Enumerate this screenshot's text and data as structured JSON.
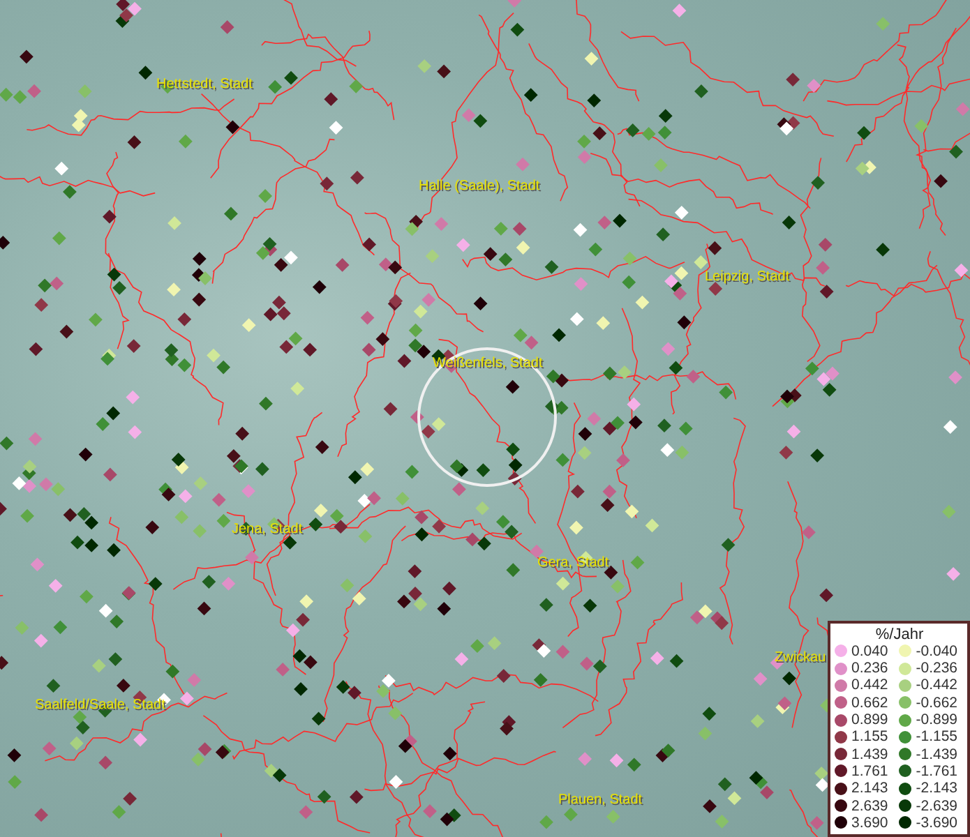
{
  "map": {
    "labels": [
      {
        "text": "Hettstedt, Stadt"
      },
      {
        "text": "Halle (Saale), Stadt"
      },
      {
        "text": "Leipzig, Stadt"
      },
      {
        "text": "Weißenfels, Stadt"
      },
      {
        "text": "Jena, Stadt"
      },
      {
        "text": "Gera, Stadt"
      },
      {
        "text": "Zwickau"
      },
      {
        "text": "Saalfeld/Saale, Stadt"
      },
      {
        "text": "Plauen, Stadt"
      }
    ]
  },
  "legend": {
    "title": "%/Jahr",
    "positive": [
      {
        "value": "0.040",
        "color": "#f5b0e8"
      },
      {
        "value": "0.236",
        "color": "#e090c8"
      },
      {
        "value": "0.442",
        "color": "#d07aa8"
      },
      {
        "value": "0.662",
        "color": "#c06088"
      },
      {
        "value": "0.899",
        "color": "#a84868"
      },
      {
        "value": "1.155",
        "color": "#903848"
      },
      {
        "value": "1.439",
        "color": "#782838"
      },
      {
        "value": "1.761",
        "color": "#601828"
      },
      {
        "value": "2.143",
        "color": "#481018"
      },
      {
        "value": "2.639",
        "color": "#380810"
      },
      {
        "value": "3.690",
        "color": "#200008"
      }
    ],
    "negative": [
      {
        "value": "-0.040",
        "color": "#f0f5b0"
      },
      {
        "value": "-0.236",
        "color": "#d0e898"
      },
      {
        "value": "-0.442",
        "color": "#a8d080"
      },
      {
        "value": "-0.662",
        "color": "#88c068"
      },
      {
        "value": "-0.899",
        "color": "#60a848"
      },
      {
        "value": "-1.155",
        "color": "#409038"
      },
      {
        "value": "-1.439",
        "color": "#307828"
      },
      {
        "value": "-1.761",
        "color": "#206020"
      },
      {
        "value": "-2.143",
        "color": "#104c10"
      },
      {
        "value": "-2.639",
        "color": "#083808"
      },
      {
        "value": "-3.690",
        "color": "#002800"
      }
    ]
  }
}
